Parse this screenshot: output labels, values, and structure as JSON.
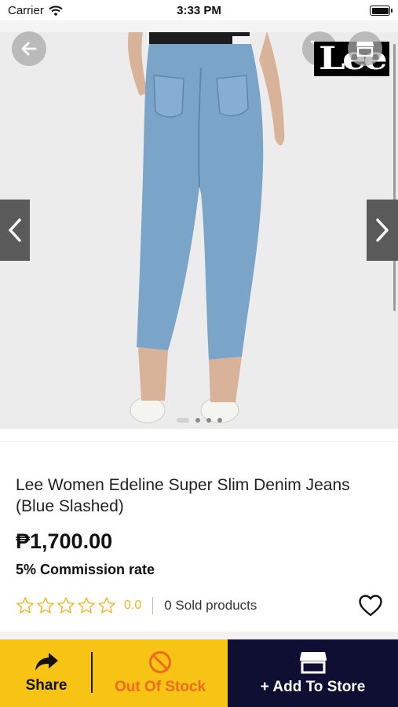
{
  "status_bar": {
    "carrier": "Carrier",
    "time": "3:33 PM"
  },
  "gallery": {
    "brand_logo_text": "Lee",
    "image_count": 4,
    "active_index": 0
  },
  "product": {
    "title": "Lee Women Edeline Super Slim Denim Jeans (Blue Slashed)",
    "price": "₱1,700.00",
    "commission": "5% Commission rate",
    "rating": "0.0",
    "rating_max_stars": 5,
    "sold": "0 Sold products"
  },
  "actions": {
    "share_label": "Share",
    "stock_label": "Out Of Stock",
    "add_label": "+ Add To Store"
  },
  "colors": {
    "yellow": "#f7c416",
    "navy": "#0f0f33",
    "out_of_stock": "#ee6a1e",
    "star": "#f3b51c"
  },
  "icons": [
    "wifi-icon",
    "battery-icon",
    "back-arrow-icon",
    "cart-icon",
    "store-icon",
    "chevron-left-icon",
    "chevron-right-icon",
    "star-outline-icon",
    "heart-outline-icon",
    "share-icon",
    "no-entry-icon"
  ]
}
